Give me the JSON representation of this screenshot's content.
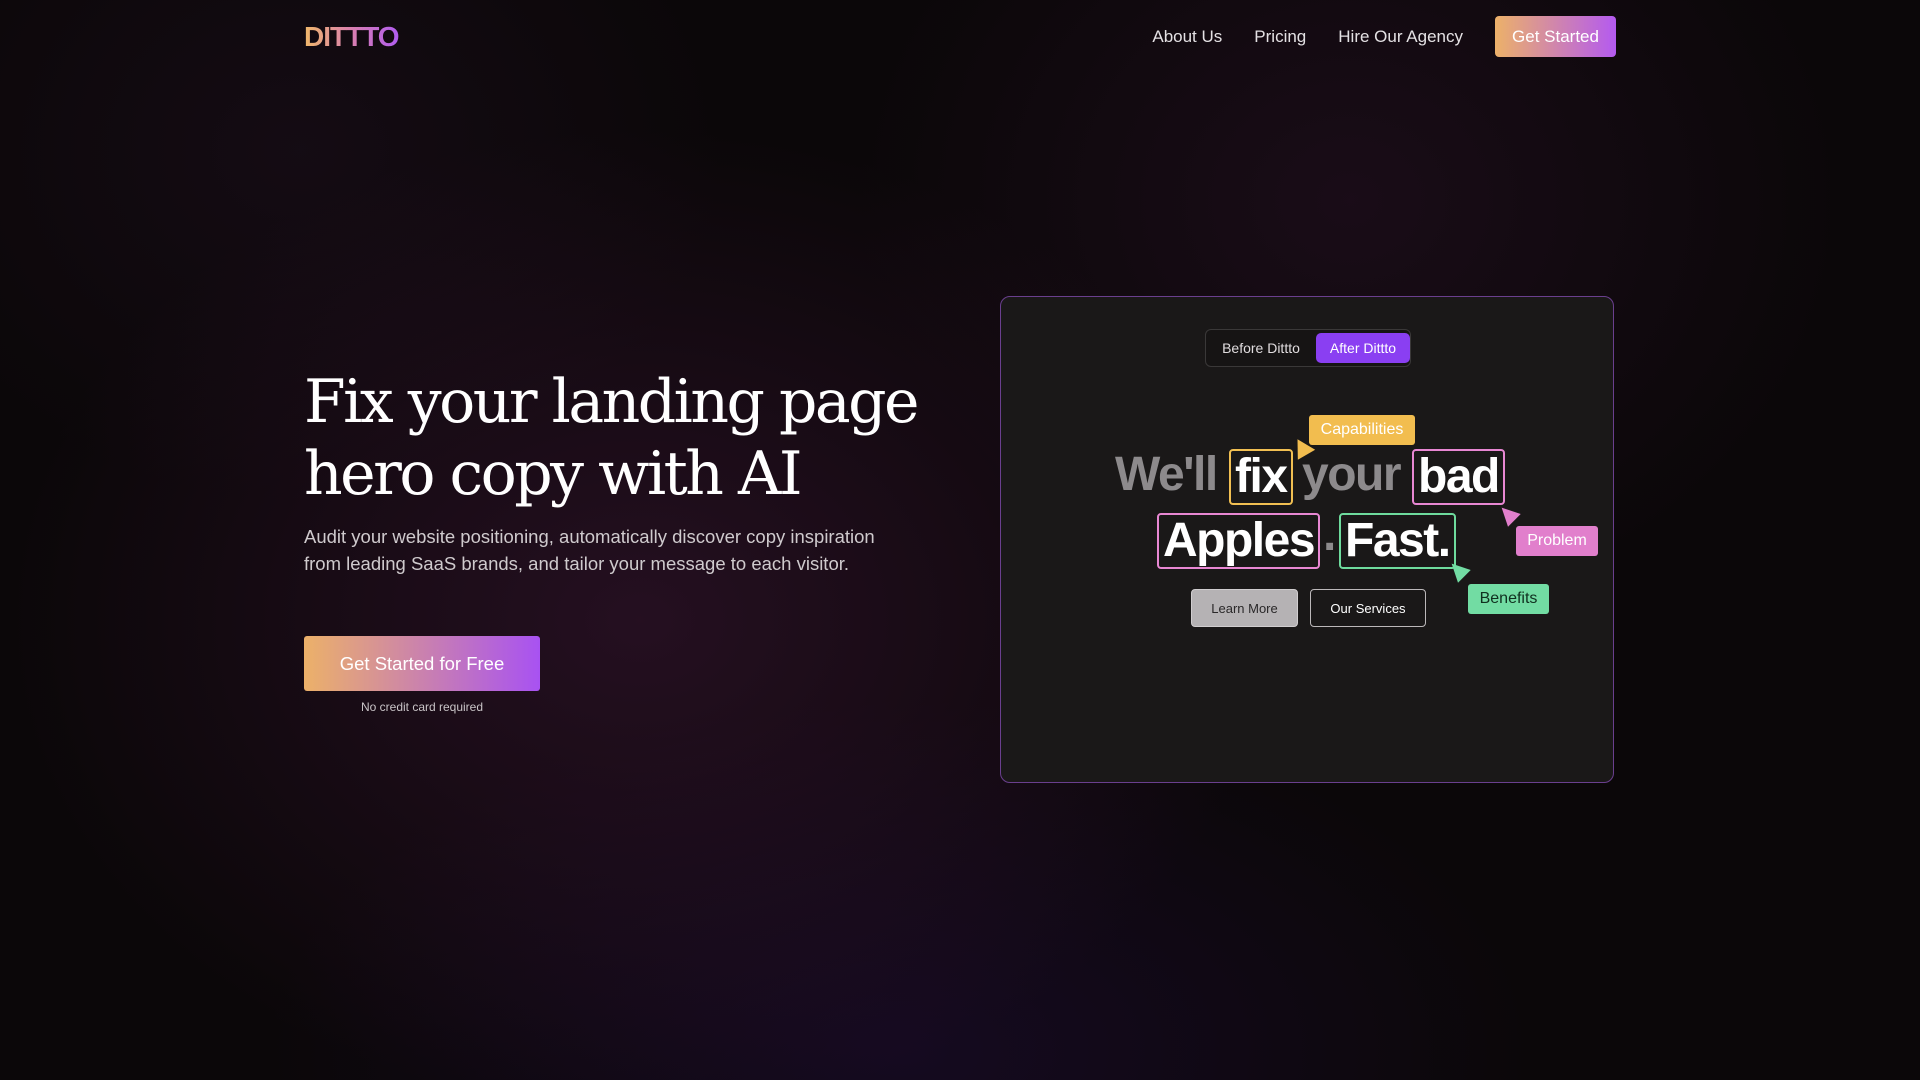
{
  "nav": {
    "logo": "DITTTO",
    "links": [
      "About Us",
      "Pricing",
      "Hire Our Agency"
    ],
    "cta": "Get Started"
  },
  "hero": {
    "title_line1": "Fix your landing page",
    "title_line2": "hero copy with AI",
    "subtitle": "Audit your website positioning, automatically discover copy inspiration from leading SaaS brands, and tailor your message to each visitor.",
    "cta": "Get Started for Free",
    "note": "No credit card required"
  },
  "preview": {
    "toggle": {
      "before": "Before Dittto",
      "after": "After Dittto",
      "selected": "after"
    },
    "headline": {
      "w1": "We'll",
      "w2": "fix",
      "w3": "your",
      "w4": "bad",
      "w5": "Apples",
      "w6": ".",
      "w7": "Fast."
    },
    "tags": {
      "capabilities": "Capabilities",
      "problem": "Problem",
      "benefits": "Benefits"
    },
    "buttons": {
      "learn_more": "Learn More",
      "our_services": "Our Services"
    }
  },
  "colors": {
    "accent_purple": "#8a3ff2",
    "accent_orange": "#ecb169",
    "tag_yellow": "#f2bd4f",
    "tag_pink": "#e17fcc",
    "tag_green": "#72dca3"
  }
}
